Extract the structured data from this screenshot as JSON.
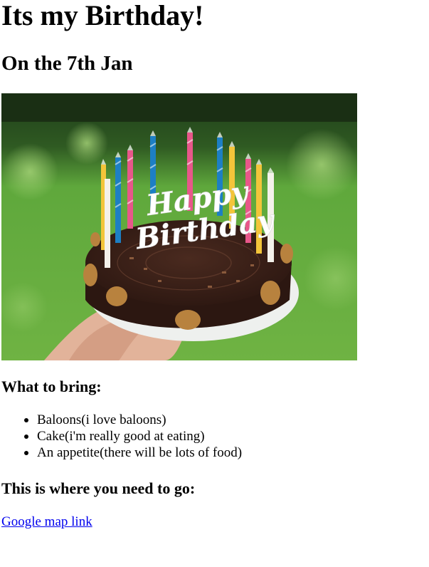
{
  "heading": "Its my Birthday!",
  "date_heading": "On the 7th Jan",
  "photo": {
    "alt": "Happy Birthday cake with candles",
    "topper_line1": "Happy",
    "topper_line2": "Birthday",
    "colors": {
      "background_green": "#5fa83c",
      "dark_foliage": "#1f3d1a",
      "chocolate": "#3a2119",
      "plate": "#eef0ee",
      "hand": "#e2b39a",
      "candle_pink": "#e8578a",
      "candle_blue": "#1d7fc4",
      "candle_yellow": "#f3c53a",
      "candle_white": "#f4f1ea",
      "walnut": "#b8823e"
    }
  },
  "bring_section": {
    "title": "What to bring:",
    "items": [
      "Baloons(i love baloons)",
      "Cake(i'm really good at eating)",
      "An appetite(there will be lots of food)"
    ]
  },
  "go_section": {
    "title": "This is where you need to go:",
    "link_text": "Google map link"
  }
}
